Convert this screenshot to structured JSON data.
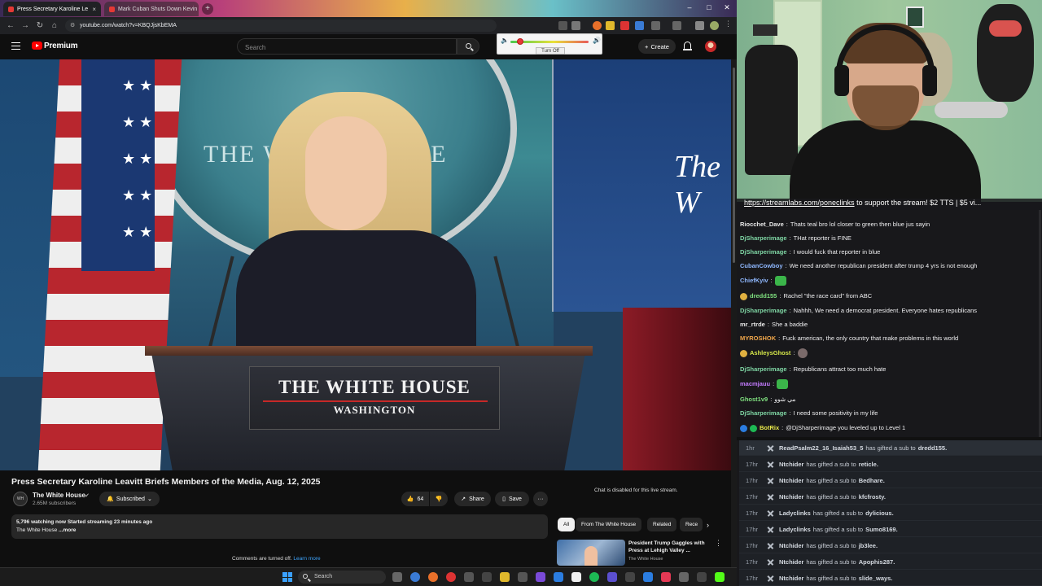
{
  "browser": {
    "tabs": [
      {
        "label": "Press Secretary Karoline Le",
        "active": true
      },
      {
        "label": "Mark Cuban Shuts Down Kevin",
        "active": false
      }
    ],
    "url": "youtube.com/watch?v=KBQJjsKbEMA"
  },
  "volume_popup": {
    "turn_off_label": "Turn Off",
    "level": 0.12
  },
  "youtube": {
    "logo_text": "Premium",
    "search_placeholder": "Search",
    "create_label": "Create",
    "video": {
      "podium_line1": "THE WHITE HOUSE",
      "podium_line2": "WASHINGTON",
      "wall_text": "THE WHITE HOUSE",
      "panel_text": "The W"
    },
    "title": "Press Secretary Karoline Leavitt Briefs Members of the Media, Aug. 12, 2025",
    "channel": {
      "name": "The White House",
      "subscribers": "2.65M subscribers",
      "avatar_text": "WH"
    },
    "subscribed_label": "Subscribed",
    "like_count": "64",
    "share_label": "Share",
    "save_label": "Save",
    "description": {
      "stats": "5,796 watching now  Started streaming 23 minutes ago",
      "line2": "The White House",
      "more": "...more"
    },
    "comments": {
      "text": "Comments are turned off.",
      "link": "Learn more"
    },
    "chat_disabled": "Chat is disabled for this live stream.",
    "chips": [
      "All",
      "From The White House",
      "Related",
      "Rece"
    ],
    "recommendation": {
      "title": "President Trump Gaggles with Press at Lehigh Valley ...",
      "channel": "The White House"
    }
  },
  "taskbar": {
    "search_placeholder": "Search"
  },
  "stream": {
    "ticker_link": "https://streamlabs.com/poneclinks",
    "ticker_rest": " to support the stream! $2 TTS | $5 vi...",
    "chat": [
      {
        "user": "Riocchet_Dave",
        "color": "#e8e8e8",
        "message": "Thats teal bro lol closer to green then blue jus sayin"
      },
      {
        "user": "DjSharperimage",
        "color": "#7fd6a4",
        "message": "THat reporter is FINE"
      },
      {
        "user": "DjSharperimage",
        "color": "#7fd6a4",
        "message": "I would fuck that reporter in blue"
      },
      {
        "user": "CubanCowboy",
        "color": "#8fb8ff",
        "message": "We need another republican president after trump 4 yrs is not enough"
      },
      {
        "user": "ChiefKyiv",
        "color": "#8fb8ff",
        "message": ""
      },
      {
        "user": "dredd155",
        "color": "#7fe07f",
        "message": "Rachel \"the race card\" from ABC"
      },
      {
        "user": "DjSharperimage",
        "color": "#7fd6a4",
        "message": "Nahhh, We need a democrat president. Everyone hates republicans"
      },
      {
        "user": "mr_rtrde",
        "color": "#e8e8e8",
        "message": "She a baddie"
      },
      {
        "user": "MYROSHOK",
        "color": "#f0a64a",
        "message": "Fuck american, the only country that make problems in this world"
      },
      {
        "user": "AshleysGhost",
        "color": "#d6e84a",
        "message": ""
      },
      {
        "user": "DjSharperimage",
        "color": "#7fd6a4",
        "message": "Republicans attract too much hate"
      },
      {
        "user": "macmjauu",
        "color": "#c47bff",
        "message": ""
      },
      {
        "user": "Ghost1v9",
        "color": "#7fe07f",
        "message": "مي شوو"
      },
      {
        "user": "DjSharperimage",
        "color": "#7fd6a4",
        "message": "I need some positivity in my life"
      },
      {
        "user": "BotRix",
        "color": "#e8e84a",
        "message": "@DjSharperimage you leveled up to Level 1"
      }
    ],
    "events": [
      {
        "time": "1hr",
        "user": "ReadPsalm22_16_Isaiah53_5",
        "text": "has gifted a sub to",
        "target": "dredd155."
      },
      {
        "time": "17hr",
        "user": "Ntchider",
        "text": "has gifted a sub to",
        "target": "reticle."
      },
      {
        "time": "17hr",
        "user": "Ntchider",
        "text": "has gifted a sub to",
        "target": "Bedhare."
      },
      {
        "time": "17hr",
        "user": "Ntchider",
        "text": "has gifted a sub to",
        "target": "kfcfrosty."
      },
      {
        "time": "17hr",
        "user": "Ladyclinks",
        "text": "has gifted a sub to",
        "target": "dylicious."
      },
      {
        "time": "17hr",
        "user": "Ladyclinks",
        "text": "has gifted a sub to",
        "target": "Sumo8169."
      },
      {
        "time": "17hr",
        "user": "Ntchider",
        "text": "has gifted a sub to",
        "target": "jb3lee."
      },
      {
        "time": "17hr",
        "user": "Ntchider",
        "text": "has gifted a sub to",
        "target": "Apophis287."
      },
      {
        "time": "17hr",
        "user": "Ntchider",
        "text": "has gifted a sub to",
        "target": "slide_ways."
      }
    ]
  }
}
